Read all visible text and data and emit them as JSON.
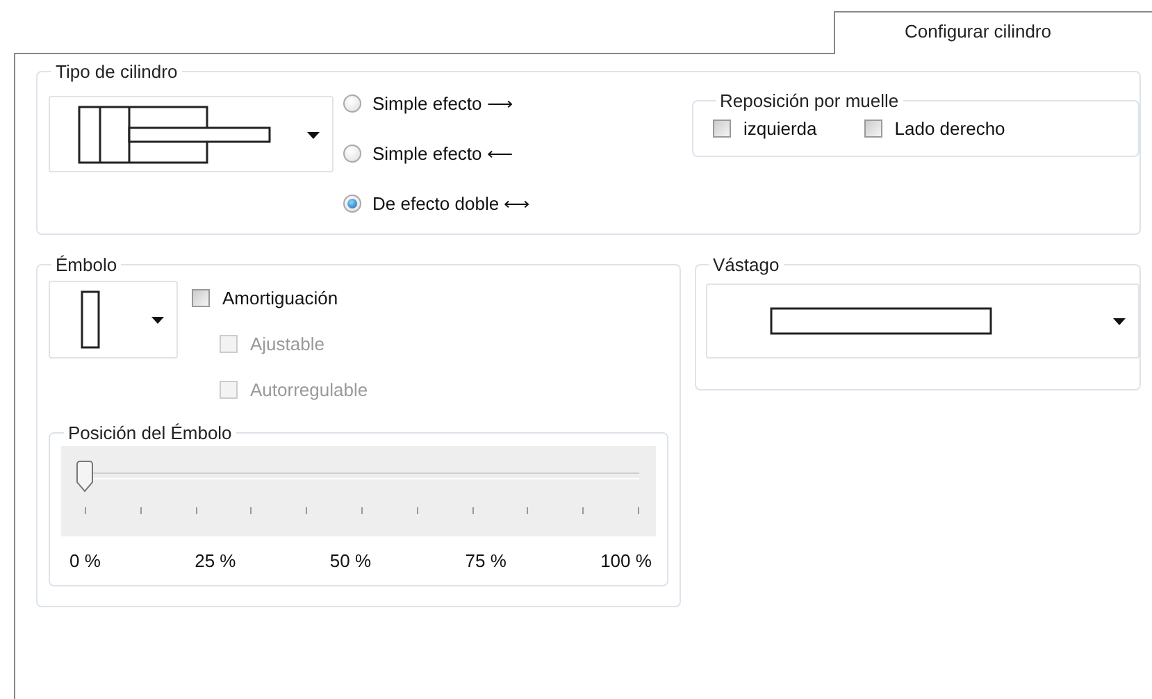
{
  "tab": {
    "label": "Configurar cilindro",
    "selected": true
  },
  "cylinder_type": {
    "title": "Tipo de cilindro",
    "options": [
      {
        "label": "Simple efecto ⟶",
        "selected": false
      },
      {
        "label": "Simple efecto ⟵",
        "selected": false
      },
      {
        "label": "De efecto doble ⟷",
        "selected": true
      }
    ],
    "spring_return": {
      "title": "Reposición por muelle",
      "options": [
        {
          "label": "izquierda",
          "checked": false
        },
        {
          "label": "Lado derecho",
          "checked": false
        }
      ]
    }
  },
  "piston": {
    "title": "Émbolo",
    "cushioning": {
      "label": "Amortiguación",
      "checked": false,
      "disabled": false,
      "children": [
        {
          "label": "Ajustable",
          "checked": false,
          "disabled": true
        },
        {
          "label": "Autorregulable",
          "checked": false,
          "disabled": true
        }
      ]
    },
    "position": {
      "title": "Posición del Émbolo",
      "level": 0,
      "labels": [
        "0 %",
        "25 %",
        "50 %",
        "75 %",
        "100 %"
      ]
    }
  },
  "rod": {
    "title": "Vástago"
  }
}
